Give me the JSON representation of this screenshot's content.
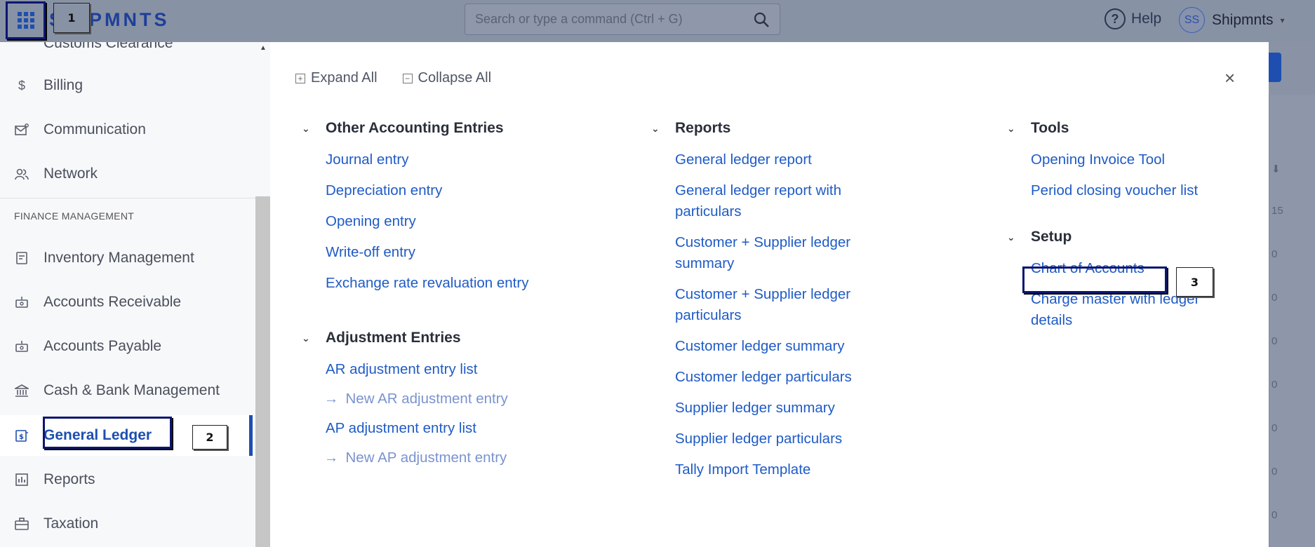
{
  "topbar": {
    "brand": "SHIPMNTS",
    "search_placeholder": "Search or type a command (Ctrl + G)",
    "help_label": "Help",
    "user_initials": "SS",
    "user_name": "Shipmnts"
  },
  "sidebar": {
    "cut_item": "Customs Clearance",
    "items_top": [
      {
        "label": "Billing",
        "icon": "dollar-icon"
      },
      {
        "label": "Communication",
        "icon": "mail-icon"
      },
      {
        "label": "Network",
        "icon": "users-icon"
      }
    ],
    "section_heading": "FINANCE MANAGEMENT",
    "items_finance": [
      {
        "label": "Inventory Management",
        "icon": "inventory-icon"
      },
      {
        "label": "Accounts Receivable",
        "icon": "receivable-icon"
      },
      {
        "label": "Accounts Payable",
        "icon": "payable-icon"
      },
      {
        "label": "Cash & Bank Management",
        "icon": "bank-icon"
      },
      {
        "label": "General Ledger",
        "icon": "ledger-icon"
      },
      {
        "label": "Reports",
        "icon": "chart-icon"
      },
      {
        "label": "Taxation",
        "icon": "briefcase-icon"
      }
    ]
  },
  "panel": {
    "expand_all": "Expand All",
    "collapse_all": "Collapse All",
    "columns": [
      {
        "groups": [
          {
            "title": "Other Accounting Entries",
            "links": [
              "Journal entry",
              "Depreciation entry",
              "Opening entry",
              "Write-off entry",
              "Exchange rate revaluation entry"
            ]
          },
          {
            "title": "Adjustment Entries",
            "links": [
              "AR adjustment entry list",
              "New AR adjustment entry",
              "AP adjustment entry list",
              "New AP adjustment entry"
            ]
          }
        ]
      },
      {
        "groups": [
          {
            "title": "Reports",
            "links": [
              "General ledger report",
              "General ledger report with particulars",
              "Customer + Supplier ledger summary",
              "Customer + Supplier ledger particulars",
              "Customer ledger summary",
              "Customer ledger particulars",
              "Supplier ledger summary",
              "Supplier ledger particulars",
              "Tally Import Template"
            ]
          }
        ]
      },
      {
        "groups": [
          {
            "title": "Tools",
            "links": [
              "Opening Invoice Tool",
              "Period closing voucher list"
            ]
          },
          {
            "title": "Setup",
            "links": [
              "Chart of Accounts",
              "Charge master with ledger details"
            ]
          }
        ]
      }
    ]
  },
  "annotations": [
    "1",
    "2",
    "3"
  ],
  "underlying": {
    "row_value_1": "15",
    "row_value_2": "0"
  },
  "colors": {
    "accent": "#1e4fb0",
    "link": "#1f5bc6",
    "annotation": "#0c1670"
  }
}
